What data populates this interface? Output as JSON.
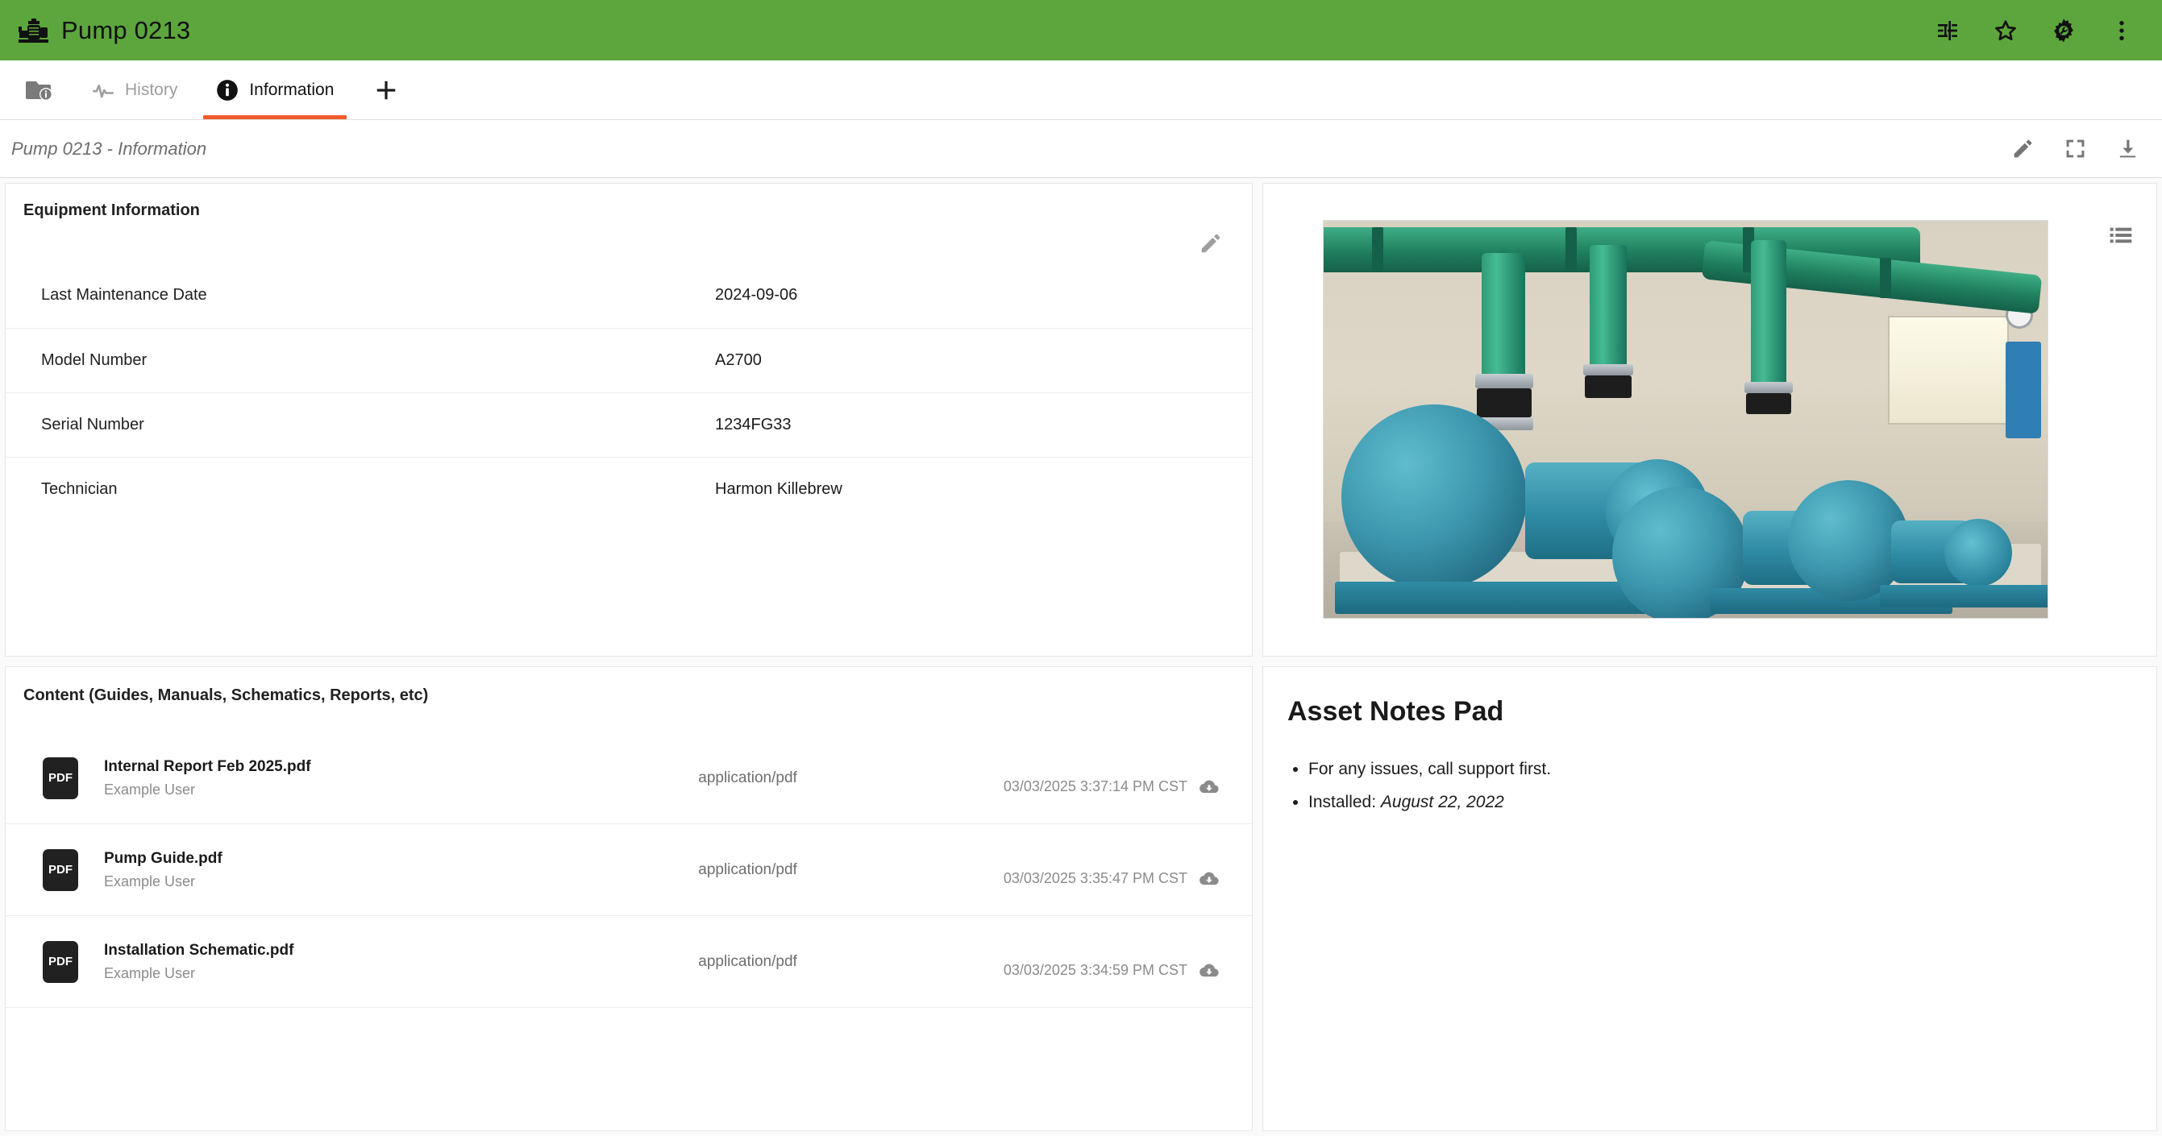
{
  "appbar": {
    "title": "Pump 0213",
    "logo_icon": "pump-icon",
    "actions": [
      {
        "name": "tune-icon",
        "label": "Tune"
      },
      {
        "name": "star-icon",
        "label": "Favorite"
      },
      {
        "name": "build-settings-icon",
        "label": "Settings"
      },
      {
        "name": "more-vert-icon",
        "label": "More options"
      }
    ]
  },
  "tabs": {
    "folder_icon": "folder-info-icon",
    "items": [
      {
        "label": "History",
        "icon": "pulse-icon",
        "active": false
      },
      {
        "label": "Information",
        "icon": "info-circle-icon",
        "active": true
      }
    ],
    "add_label": "+"
  },
  "subbar": {
    "title": "Pump 0213 - Information",
    "actions": [
      {
        "name": "edit-pencil-icon",
        "label": "Edit"
      },
      {
        "name": "fullscreen-icon",
        "label": "Fullscreen"
      },
      {
        "name": "download-icon",
        "label": "Download"
      }
    ]
  },
  "equipment": {
    "heading": "Equipment Information",
    "edit_icon": "edit-pencil-icon",
    "rows": [
      {
        "key": "Last Maintenance Date",
        "value": "2024-09-06"
      },
      {
        "key": "Model Number",
        "value": "A2700"
      },
      {
        "key": "Serial Number",
        "value": "1234FG33"
      },
      {
        "key": "Technician",
        "value": "Harmon Killebrew"
      }
    ]
  },
  "image_panel": {
    "list_icon": "list-view-icon",
    "alt": "Photograph of three teal centrifugal pumps with green overhead piping in a pump house"
  },
  "content_panel": {
    "heading": "Content (Guides, Manuals, Schematics, Reports, etc)",
    "files": [
      {
        "badge": "PDF",
        "name": "Internal Report Feb 2025.pdf",
        "user": "Example User",
        "mime": "application/pdf",
        "date": "03/03/2025 3:37:14 PM CST",
        "download_icon": "cloud-download-icon"
      },
      {
        "badge": "PDF",
        "name": "Pump Guide.pdf",
        "user": "Example User",
        "mime": "application/pdf",
        "date": "03/03/2025 3:35:47 PM CST",
        "download_icon": "cloud-download-icon"
      },
      {
        "badge": "PDF",
        "name": "Installation Schematic.pdf",
        "user": "Example User",
        "mime": "application/pdf",
        "date": "03/03/2025 3:34:59 PM CST",
        "download_icon": "cloud-download-icon"
      }
    ]
  },
  "notes": {
    "title": "Asset Notes Pad",
    "items": [
      {
        "text": "For any issues, call support first.",
        "emphasis": ""
      },
      {
        "text": "Installed: ",
        "emphasis": "August 22, 2022"
      }
    ]
  },
  "colors": {
    "appbar_green": "#5CA63D",
    "tab_accent_orange": "#EF5B2B",
    "badge_dark": "#212121",
    "muted_text": "#8b8b8b"
  }
}
